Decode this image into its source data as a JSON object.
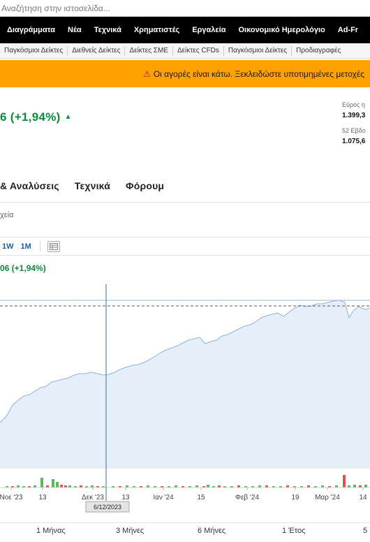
{
  "search": {
    "placeholder": "Αναζήτηση στην ιστοσελίδα..."
  },
  "main_nav": [
    "Διαγράμματα",
    "Νέα",
    "Τεχνικά",
    "Χρηματιστές",
    "Εργαλεία",
    "Οικονομικό Ημερολόγιο",
    "Ad-Fr"
  ],
  "sub_nav": [
    "Παγκόσμιοι Δείκτες",
    "Διεθνείς Δείκτες",
    "Δείκτες ΣΜΕ",
    "Δείκτες CFDs",
    "Παγκόσμιοι Δείκτες",
    "Προδιαγραφές"
  ],
  "alert": {
    "icon": "alert-icon",
    "text": "Οι αγορές είναι κάτω. Ξεκλειδώστε υποτιμημένες μετοχές"
  },
  "quote": {
    "change": "6 (+1,94%)",
    "direction": "up"
  },
  "ranges_info": [
    {
      "label": "Εύρος η",
      "value": "1.399,3"
    },
    {
      "label": "52 Εβδο",
      "value": "1.075,6"
    }
  ],
  "tabs": [
    "& Αναλύσεις",
    "Τεχνικά",
    "Φόρουμ"
  ],
  "breadcrumb": "χεία",
  "chart_toolbar": {
    "periods": [
      "1W",
      "1M"
    ],
    "table_icon": "table-icon"
  },
  "chart_header": {
    "change": "06 (+1,94%)"
  },
  "chart_data": {
    "type": "area",
    "x_tick_labels": [
      "Νοε '23",
      "13",
      "Δεκ '23",
      "13",
      "Ιαν '24",
      "15",
      "Φεβ '24",
      "19",
      "Μαρ '24",
      "14"
    ],
    "crosshair_label": "6/12/2023",
    "colors": {
      "line": "#8ab4e0",
      "fill": "#e6eff9",
      "up_volume": "#5cb85c",
      "down_volume": "#d9534f",
      "crosshair": "#3a6ea5"
    }
  },
  "range_buttons": [
    "1 Μήνας",
    "3 Μήνες",
    "6 Μήνες",
    "1 Έτος",
    "5"
  ]
}
